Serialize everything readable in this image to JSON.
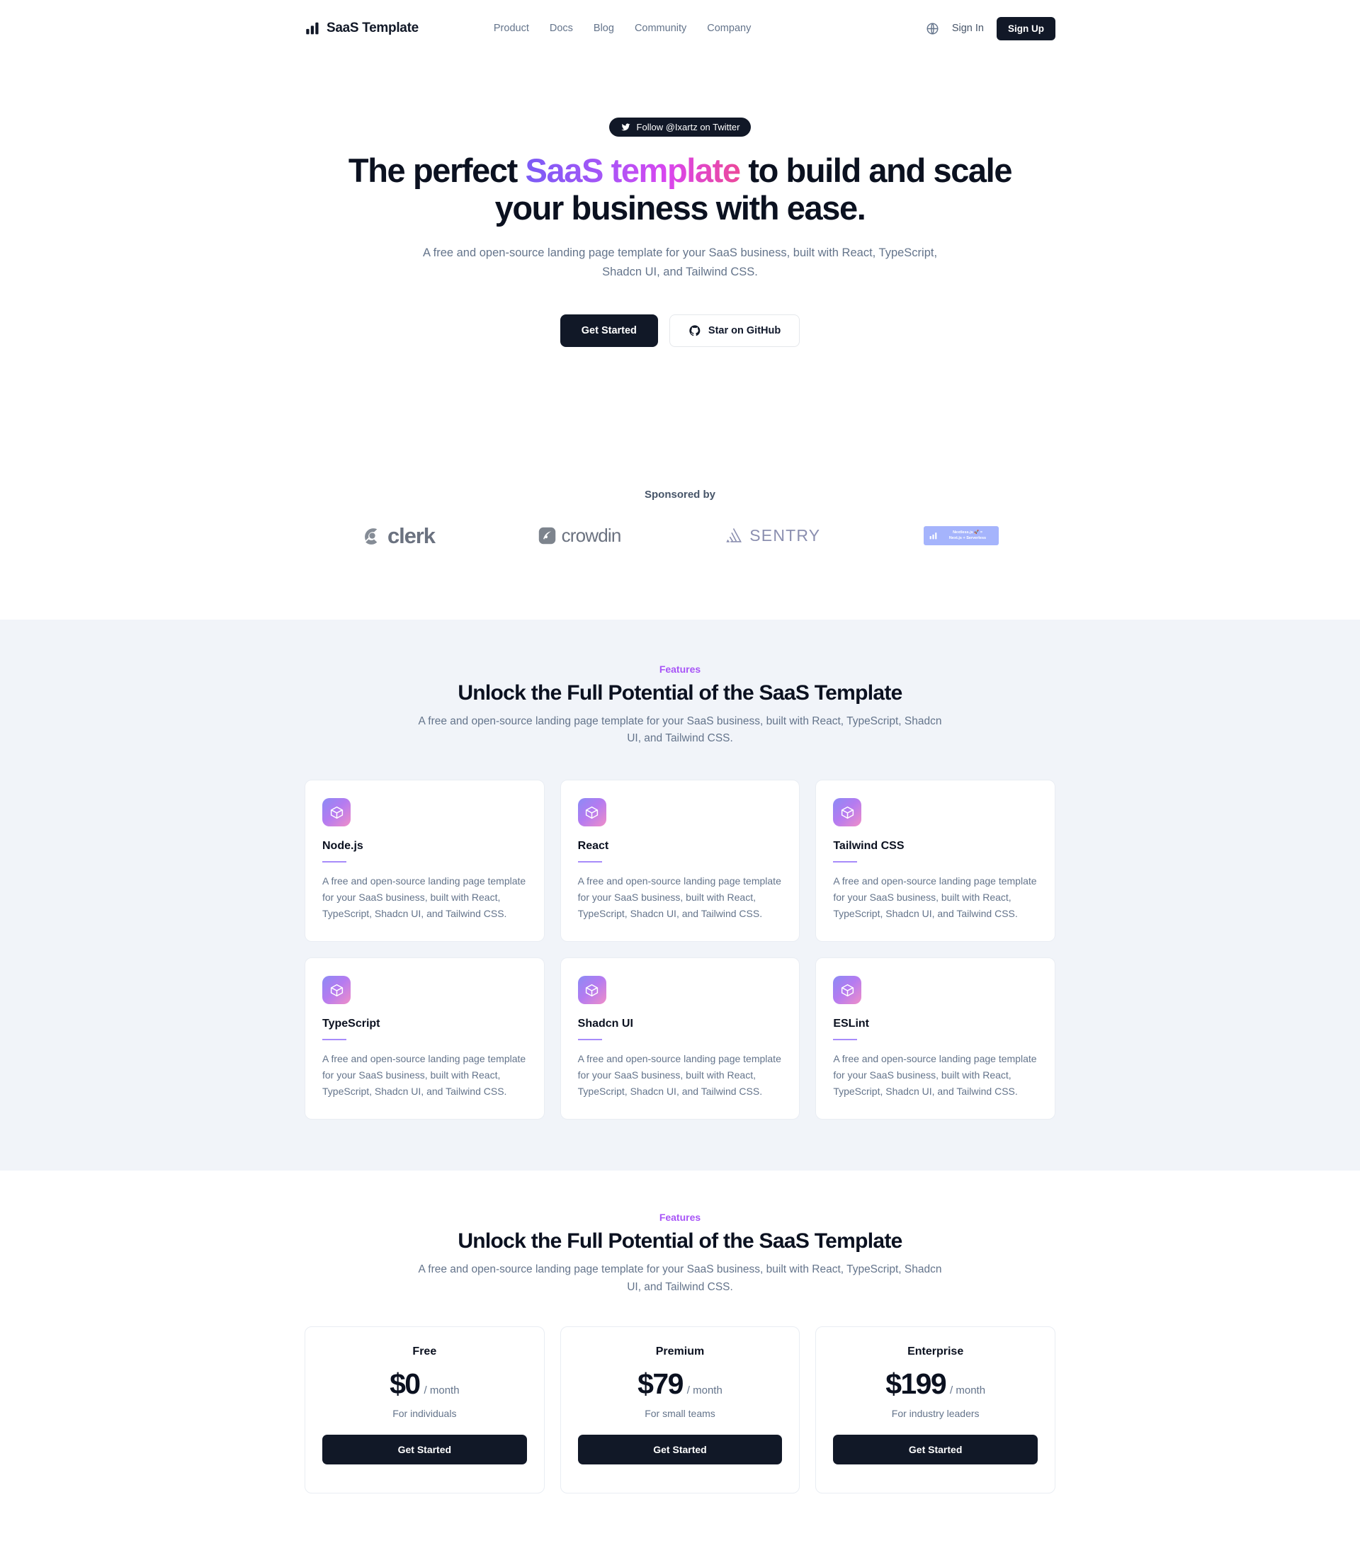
{
  "nav": {
    "brand": {
      "logo_icon": "bar-chart-logo-icon",
      "name": "SaaS Template"
    },
    "links": [
      {
        "label": "Product"
      },
      {
        "label": "Docs"
      },
      {
        "label": "Blog"
      },
      {
        "label": "Community"
      },
      {
        "label": "Company"
      }
    ],
    "locale_icon": "globe-icon",
    "sign_in_label": "Sign In",
    "sign_up_label": "Sign Up"
  },
  "hero": {
    "badge": {
      "icon": "twitter-bird-icon",
      "label": "Follow @Ixartz on Twitter"
    },
    "title_part1": "The perfect ",
    "title_highlight": "SaaS template",
    "title_part2": " to build and scale your business with ease.",
    "subtitle": "A free and open-source landing page template for your SaaS business, built with React, TypeScript, Shadcn UI, and Tailwind CSS.",
    "primary_button": "Get Started",
    "secondary_button": "Star on GitHub",
    "secondary_icon": "github-icon"
  },
  "sponsors": {
    "label": "Sponsored by",
    "items": [
      {
        "name": "clerk",
        "text": "clerk",
        "icon": "clerk-logo-icon"
      },
      {
        "name": "crowdin",
        "text": "crowdin",
        "icon": "crowdin-logo-icon"
      },
      {
        "name": "sentry",
        "text": "SENTRY",
        "icon": "sentry-logo-icon"
      },
      {
        "name": "nextless",
        "line1": "Nextless.js 🚀 =",
        "line2": "Next.js + Serverless",
        "icon": "nextless-logo-icon"
      }
    ]
  },
  "features_section": {
    "eyebrow": "Features",
    "title": "Unlock the Full Potential of the SaaS Template",
    "subtitle": "A free and open-source landing page template for your SaaS business, built with React, TypeScript, Shadcn UI, and Tailwind CSS.",
    "cards": [
      {
        "icon": "cube-icon",
        "title": "Node.js",
        "description": "A free and open-source landing page template for your SaaS business, built with React, TypeScript, Shadcn UI, and Tailwind CSS."
      },
      {
        "icon": "cube-icon",
        "title": "React",
        "description": "A free and open-source landing page template for your SaaS business, built with React, TypeScript, Shadcn UI, and Tailwind CSS."
      },
      {
        "icon": "cube-icon",
        "title": "Tailwind CSS",
        "description": "A free and open-source landing page template for your SaaS business, built with React, TypeScript, Shadcn UI, and Tailwind CSS."
      },
      {
        "icon": "cube-icon",
        "title": "TypeScript",
        "description": "A free and open-source landing page template for your SaaS business, built with React, TypeScript, Shadcn UI, and Tailwind CSS."
      },
      {
        "icon": "cube-icon",
        "title": "Shadcn UI",
        "description": "A free and open-source landing page template for your SaaS business, built with React, TypeScript, Shadcn UI, and Tailwind CSS."
      },
      {
        "icon": "cube-icon",
        "title": "ESLint",
        "description": "A free and open-source landing page template for your SaaS business, built with React, TypeScript, Shadcn UI, and Tailwind CSS."
      }
    ]
  },
  "pricing_section": {
    "eyebrow": "Features",
    "title": "Unlock the Full Potential of the SaaS Template",
    "subtitle": "A free and open-source landing page template for your SaaS business, built with React, TypeScript, Shadcn UI, and Tailwind CSS.",
    "plans": [
      {
        "name": "Free",
        "amount": "$0",
        "period": "/ month",
        "tagline": "For individuals",
        "button": "Get Started"
      },
      {
        "name": "Premium",
        "amount": "$79",
        "period": "/ month",
        "tagline": "For small teams",
        "button": "Get Started"
      },
      {
        "name": "Enterprise",
        "amount": "$199",
        "period": "/ month",
        "tagline": "For industry leaders",
        "button": "Get Started"
      }
    ]
  },
  "colors": {
    "dark": "#111827",
    "accent_purple": "#a855f7",
    "gradient_start": "#7b5cf5",
    "gradient_end": "#ec4899",
    "section_bg": "#f1f4f9",
    "muted_text": "#64748b"
  }
}
